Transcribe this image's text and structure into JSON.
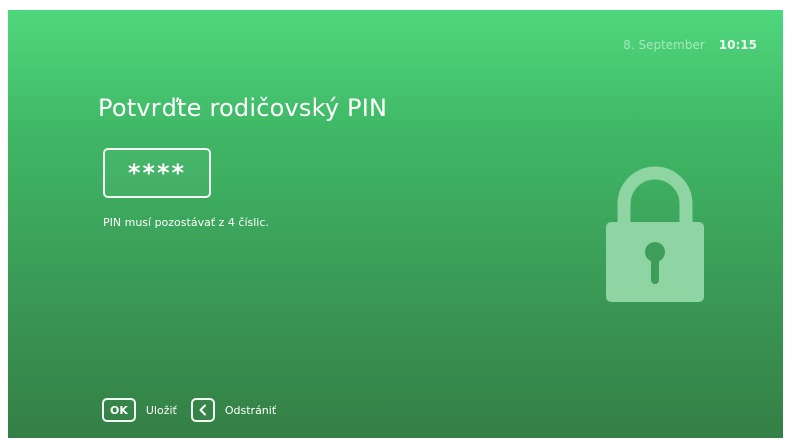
{
  "header": {
    "date": "8. September",
    "time": "10:15"
  },
  "dialog": {
    "title": "Potvrďte rodičovský PIN",
    "pin_mask": "****",
    "hint": "PIN musí pozostávať z 4 číslic."
  },
  "footer": {
    "ok_key": "OK",
    "ok_label": "Uložiť",
    "back_label": "Odstrániť"
  },
  "icons": {
    "lock": "lock-icon",
    "back": "chevron-left-icon"
  },
  "colors": {
    "gradient_top": "#4fd77c",
    "gradient_bottom": "#347f46",
    "text": "#ffffff",
    "lock_fill": "#8fd5a4"
  }
}
